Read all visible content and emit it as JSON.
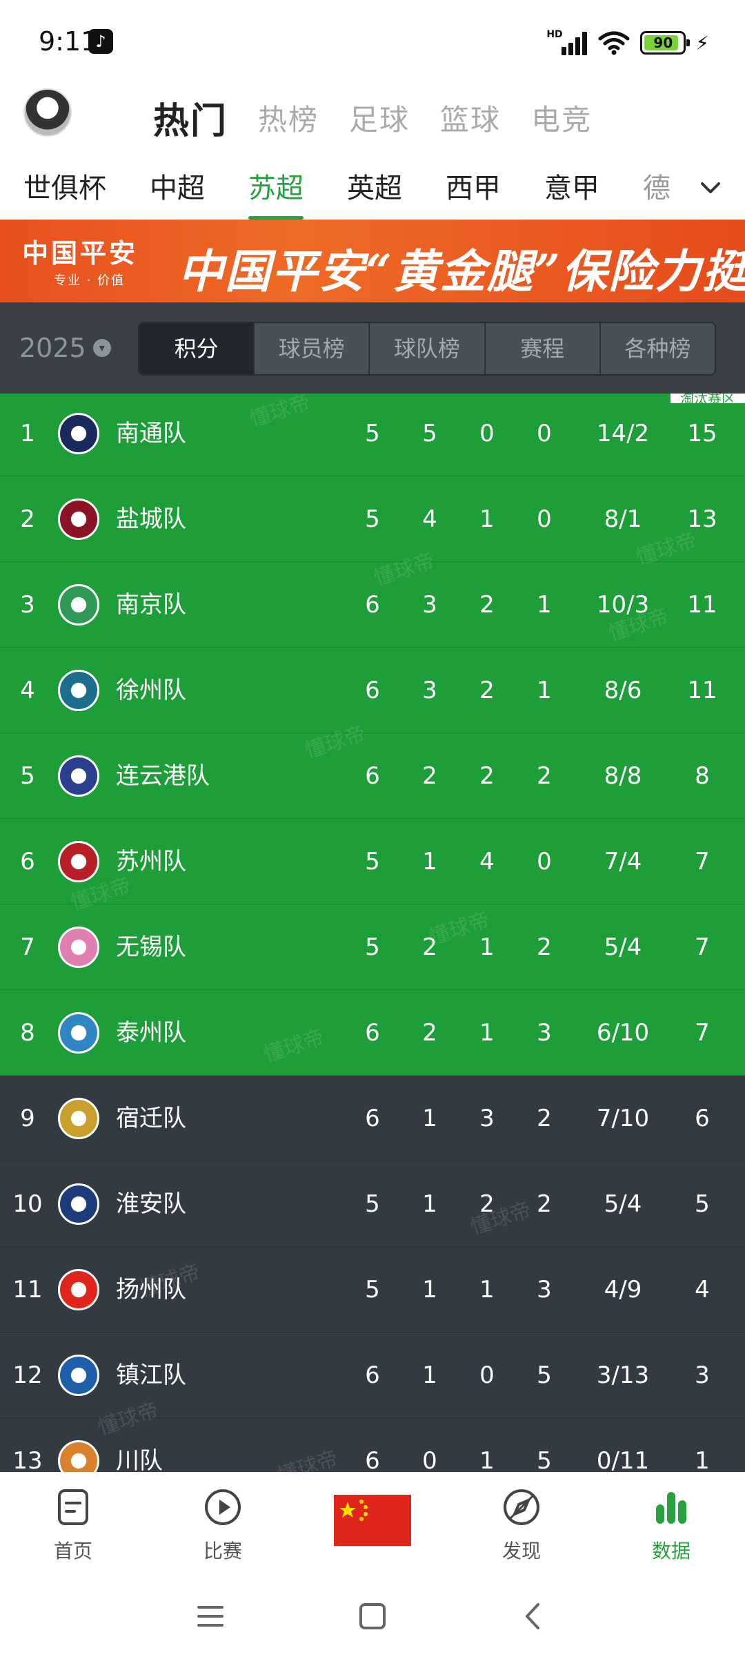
{
  "status_bar": {
    "time": "9:11",
    "hd": "HD",
    "battery": "90",
    "battery_level": 0.9
  },
  "top_tabs": [
    "热门",
    "热榜",
    "足球",
    "篮球",
    "电竞"
  ],
  "league_tabs": [
    "世俱杯",
    "中超",
    "苏超",
    "英超",
    "西甲",
    "意甲",
    "德"
  ],
  "active_league": "苏超",
  "banner": {
    "brand": "中国平安",
    "brand_sub": "专业 · 价值",
    "slogan": "中国平安“黄金腿”保险力挺苏超"
  },
  "season": "2025",
  "segments": [
    "积分",
    "球员榜",
    "球队榜",
    "赛程",
    "各种榜"
  ],
  "promo_badge": "淘汰赛区",
  "watermark_text": "懂球帝",
  "standings": [
    {
      "rank": "1",
      "team": "南通队",
      "played": "5",
      "win": "5",
      "draw": "0",
      "loss": "0",
      "goals": "14/2",
      "points": "15",
      "zone": "green",
      "logo_color": "#1b2a5c"
    },
    {
      "rank": "2",
      "team": "盐城队",
      "played": "5",
      "win": "4",
      "draw": "1",
      "loss": "0",
      "goals": "8/1",
      "points": "13",
      "zone": "green",
      "logo_color": "#8a1426"
    },
    {
      "rank": "3",
      "team": "南京队",
      "played": "6",
      "win": "3",
      "draw": "2",
      "loss": "1",
      "goals": "10/3",
      "points": "11",
      "zone": "green",
      "logo_color": "#2f9a55"
    },
    {
      "rank": "4",
      "team": "徐州队",
      "played": "6",
      "win": "3",
      "draw": "2",
      "loss": "1",
      "goals": "8/6",
      "points": "11",
      "zone": "green",
      "logo_color": "#1d6e8c"
    },
    {
      "rank": "5",
      "team": "连云港队",
      "played": "6",
      "win": "2",
      "draw": "2",
      "loss": "2",
      "goals": "8/8",
      "points": "8",
      "zone": "green",
      "logo_color": "#2c3f8f"
    },
    {
      "rank": "6",
      "team": "苏州队",
      "played": "5",
      "win": "1",
      "draw": "4",
      "loss": "0",
      "goals": "7/4",
      "points": "7",
      "zone": "green",
      "logo_color": "#b81f27"
    },
    {
      "rank": "7",
      "team": "无锡队",
      "played": "5",
      "win": "2",
      "draw": "1",
      "loss": "2",
      "goals": "5/4",
      "points": "7",
      "zone": "green",
      "logo_color": "#e07fb0"
    },
    {
      "rank": "8",
      "team": "泰州队",
      "played": "6",
      "win": "2",
      "draw": "1",
      "loss": "3",
      "goals": "6/10",
      "points": "7",
      "zone": "green",
      "logo_color": "#2f86c2"
    },
    {
      "rank": "9",
      "team": "宿迁队",
      "played": "6",
      "win": "1",
      "draw": "3",
      "loss": "2",
      "goals": "7/10",
      "points": "6",
      "zone": "dark",
      "logo_color": "#c9a02b"
    },
    {
      "rank": "10",
      "team": "淮安队",
      "played": "5",
      "win": "1",
      "draw": "2",
      "loss": "2",
      "goals": "5/4",
      "points": "5",
      "zone": "dark",
      "logo_color": "#1d3c7c"
    },
    {
      "rank": "11",
      "team": "扬州队",
      "played": "5",
      "win": "1",
      "draw": "1",
      "loss": "3",
      "goals": "4/9",
      "points": "4",
      "zone": "dark",
      "logo_color": "#e0261c"
    },
    {
      "rank": "12",
      "team": "镇江队",
      "played": "6",
      "win": "1",
      "draw": "0",
      "loss": "5",
      "goals": "3/13",
      "points": "3",
      "zone": "dark",
      "logo_color": "#1d5fa8"
    },
    {
      "rank": "13",
      "team": "川队",
      "played": "6",
      "win": "0",
      "draw": "1",
      "loss": "5",
      "goals": "0/11",
      "points": "1",
      "zone": "dark",
      "logo_color": "#d9822b"
    }
  ],
  "bottom_nav": [
    {
      "label": "首页",
      "icon": "home-doc-icon"
    },
    {
      "label": "比赛",
      "icon": "play-circle-icon"
    },
    {
      "label": "",
      "icon": "china-flag-icon"
    },
    {
      "label": "发现",
      "icon": "compass-icon"
    },
    {
      "label": "数据",
      "icon": "bar-chart-icon"
    }
  ],
  "colors": {
    "accent": "#2aa140",
    "promo_zone": "#1e9e38",
    "dark_zone": "#343a41",
    "banner": "#e8501f"
  }
}
